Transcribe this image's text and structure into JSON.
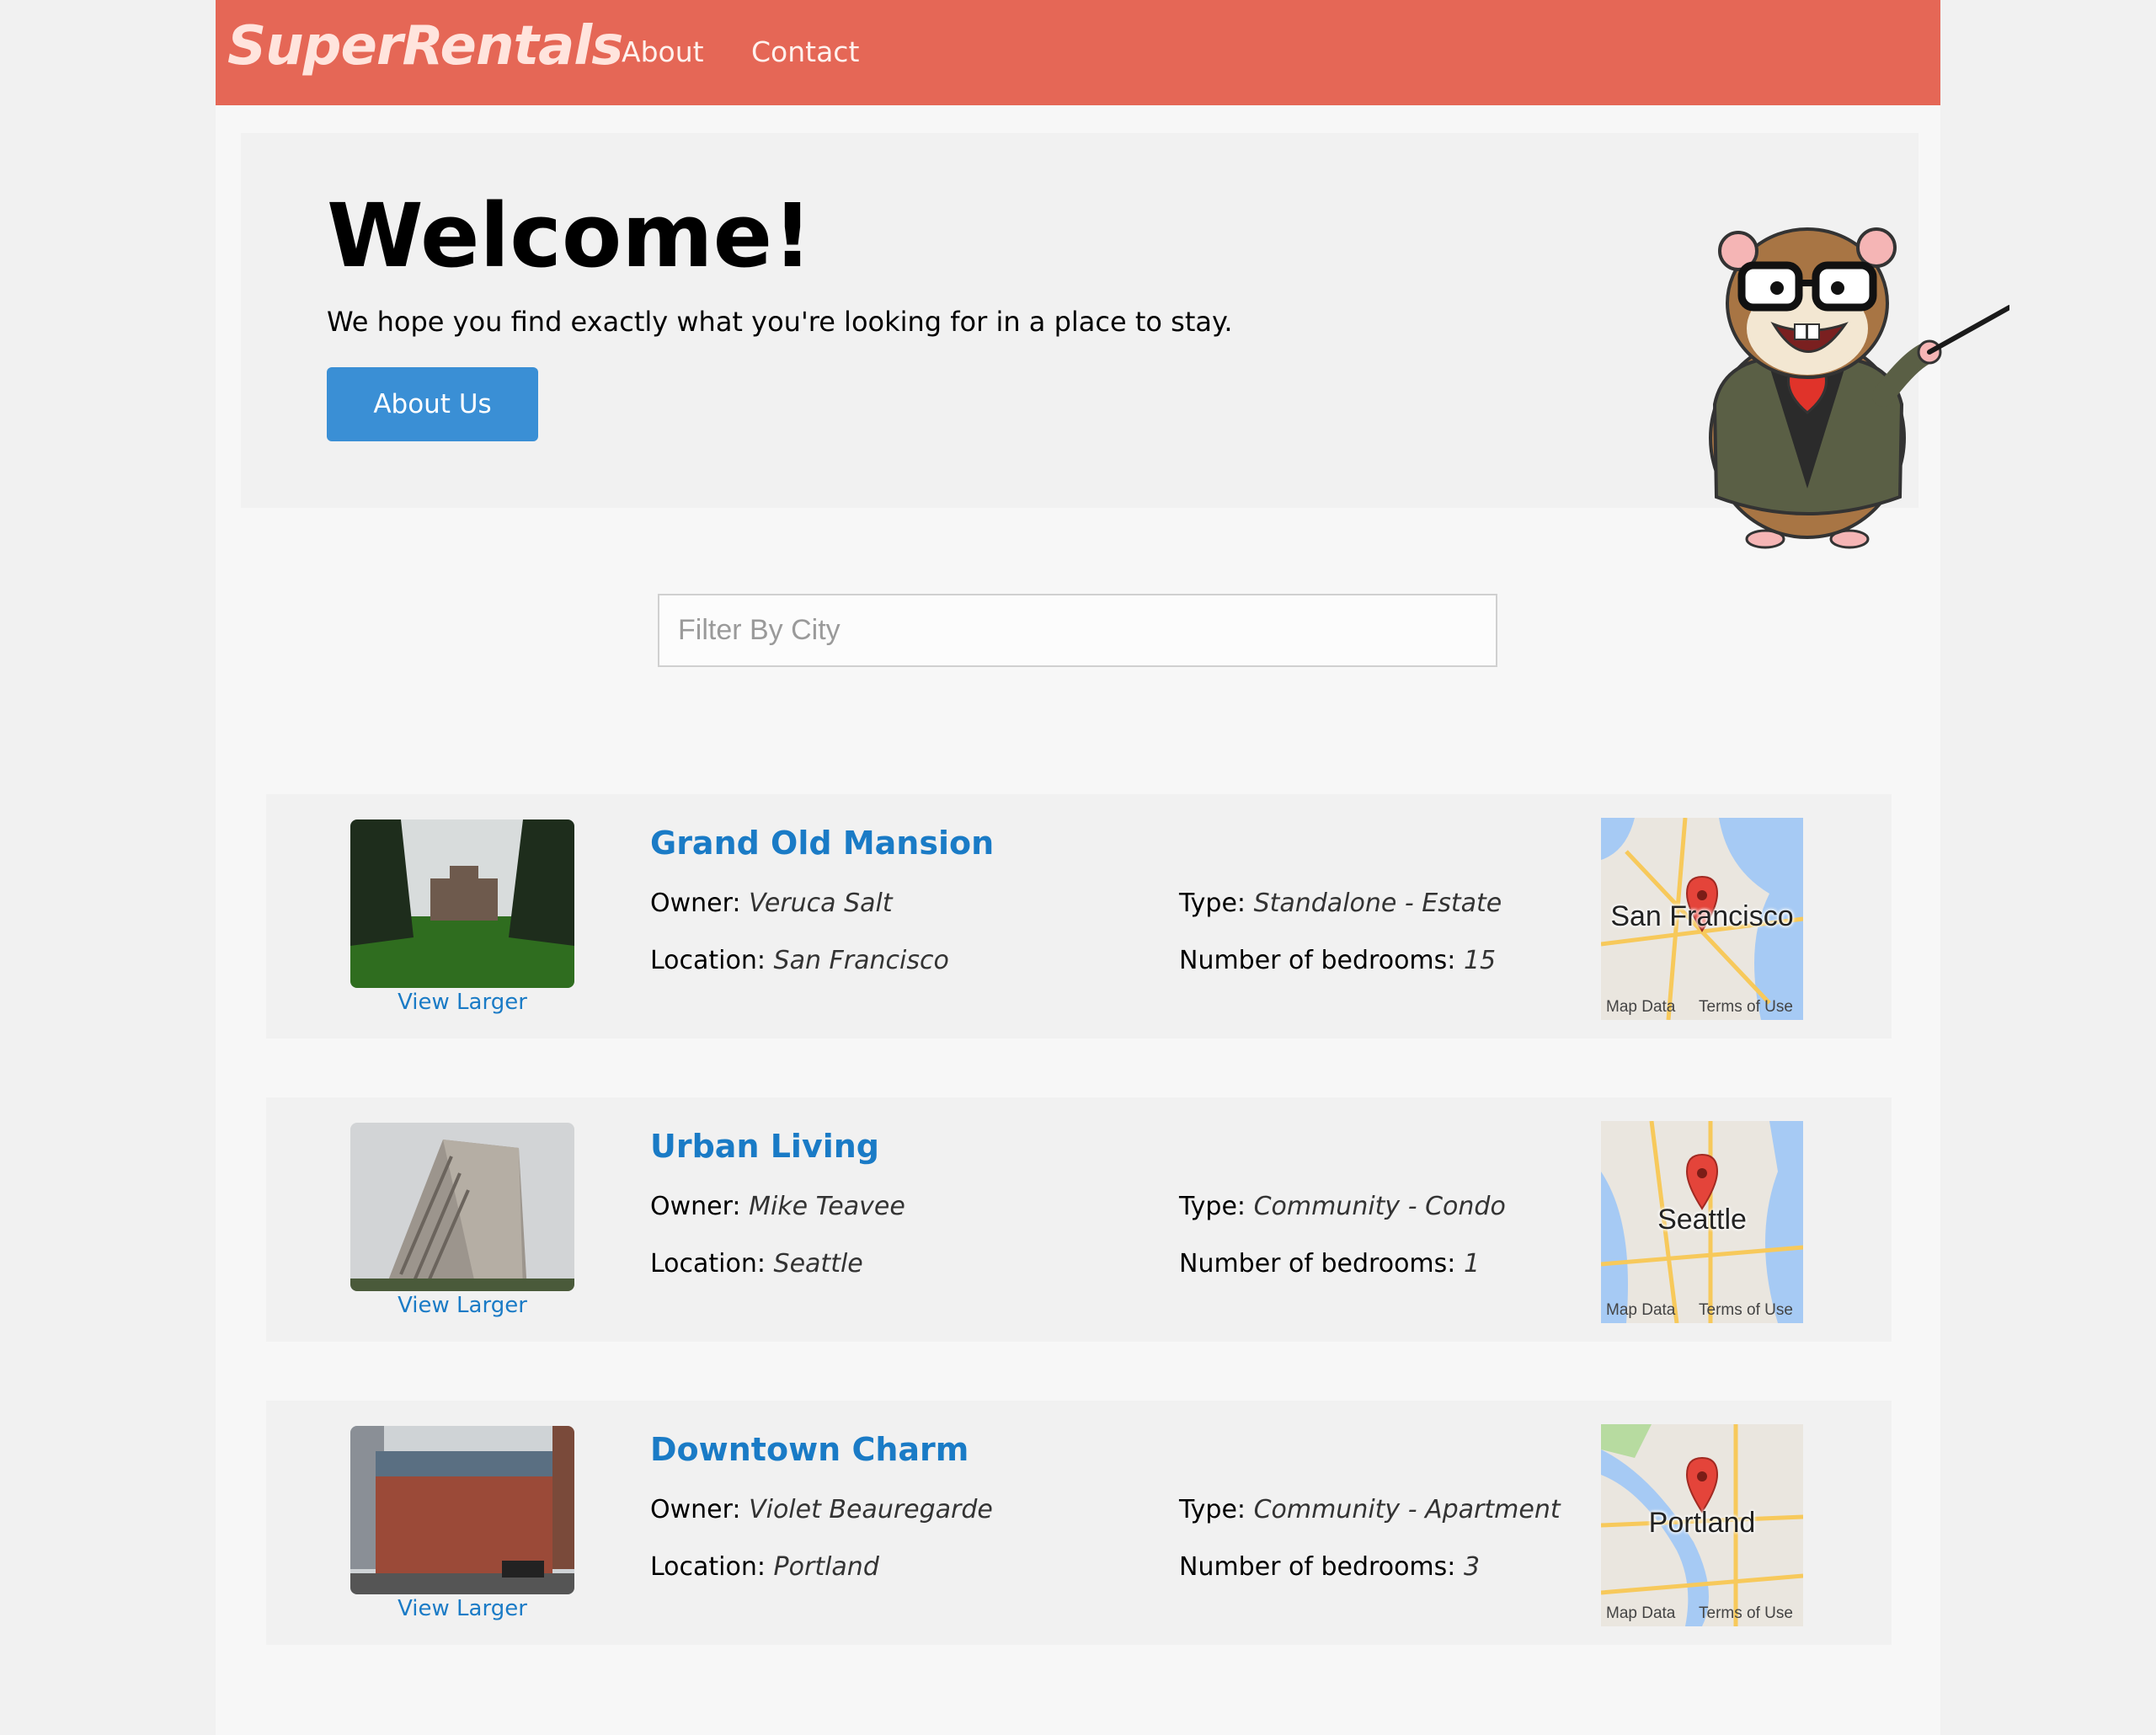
{
  "header": {
    "brand": "SuperRentals",
    "nav": [
      {
        "label": "About"
      },
      {
        "label": "Contact"
      }
    ]
  },
  "jumbotron": {
    "title": "Welcome!",
    "text": "We hope you find exactly what you're looking for in a place to stay.",
    "button_label": "About Us"
  },
  "filter": {
    "placeholder": "Filter By City",
    "value": ""
  },
  "labels": {
    "owner": "Owner:",
    "location": "Location:",
    "type": "Type:",
    "bedrooms": "Number of bedrooms:",
    "view_larger": "View Larger",
    "map_data": "Map Data",
    "terms": "Terms of Use"
  },
  "rentals": [
    {
      "title": "Grand Old Mansion",
      "owner": "Veruca Salt",
      "city": "San Francisco",
      "type": "Standalone - Estate",
      "bedrooms": "15"
    },
    {
      "title": "Urban Living",
      "owner": "Mike Teavee",
      "city": "Seattle",
      "type": "Community - Condo",
      "bedrooms": "1"
    },
    {
      "title": "Downtown Charm",
      "owner": "Violet Beauregarde",
      "city": "Portland",
      "type": "Community - Apartment",
      "bedrooms": "3"
    }
  ],
  "colors": {
    "navbar": "#e56756",
    "link": "#1a7bc6",
    "button": "#3a8fd5"
  }
}
